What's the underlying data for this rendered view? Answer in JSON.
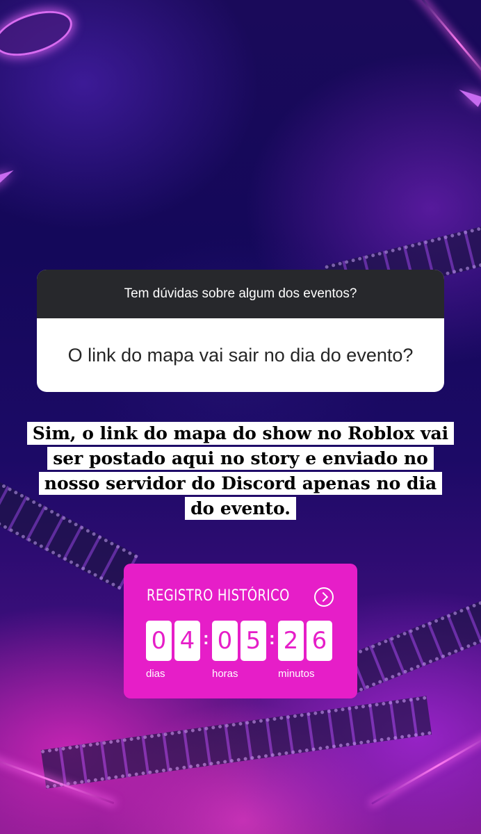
{
  "question_box": {
    "prompt": "Tem dúvidas sobre algum dos eventos?",
    "question": "O link do mapa vai sair no dia do evento?"
  },
  "answer": {
    "lines": [
      "Sim, o link do mapa do show no Roblox vai",
      "ser postado aqui no story e enviado no",
      "nosso servidor do Discord apenas no dia",
      "do evento."
    ]
  },
  "countdown": {
    "title": "REGISTRO HISTÓRICO",
    "digits": [
      "0",
      "4",
      "0",
      "5",
      "2",
      "6"
    ],
    "labels": {
      "days": "dias",
      "hours": "horas",
      "minutes": "minutos"
    },
    "accent": "#e61ec8"
  },
  "icons": {
    "countdown_arrow": "chevron-right-circle-icon"
  }
}
